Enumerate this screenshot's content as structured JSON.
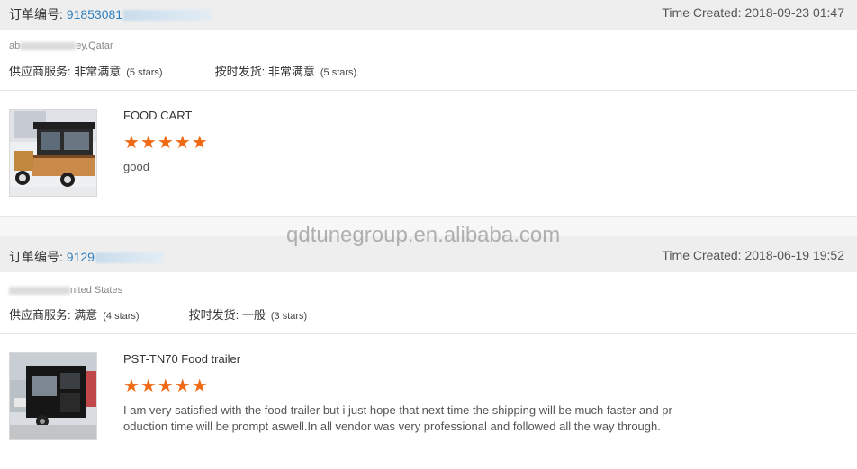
{
  "orders": [
    {
      "order_label": "订单编号: ",
      "order_id": "91853081",
      "time_created": "Time Created: 2018-09-23 01:47",
      "address_prefix": "ab",
      "address_suffix": "ey,Qatar",
      "supplier_service_label": "供应商服务: ",
      "supplier_service_value": "非常满意",
      "supplier_service_stars": "(5 stars)",
      "shipping_label": "按时发货: ",
      "shipping_value": "非常满意",
      "shipping_stars": "(5 stars)",
      "product_title": "FOOD CART",
      "stars": "★★★★★",
      "review": "good"
    },
    {
      "order_label": "订单编号: ",
      "order_id": "9129",
      "time_created": "Time Created: 2018-06-19 19:52",
      "address_prefix": "",
      "address_suffix": "nited States",
      "supplier_service_label": "供应商服务: ",
      "supplier_service_value": "满意",
      "supplier_service_stars": "(4 stars)",
      "shipping_label": "按时发货: ",
      "shipping_value": "一般",
      "shipping_stars": "(3 stars)",
      "product_title": "PST-TN70 Food trailer",
      "stars": "★★★★★",
      "review": "I am very satisfied with the food trailer but i just hope that next time the shipping will be much faster and pr oduction time will be prompt aswell.In all vendor was very professional and followed all the way through."
    }
  ],
  "watermark": "qdtunegroup.en.alibaba.com",
  "colors": {
    "star": "#f06a16",
    "order_id": "#2f7fbf",
    "header_bg": "#eeeeee"
  }
}
